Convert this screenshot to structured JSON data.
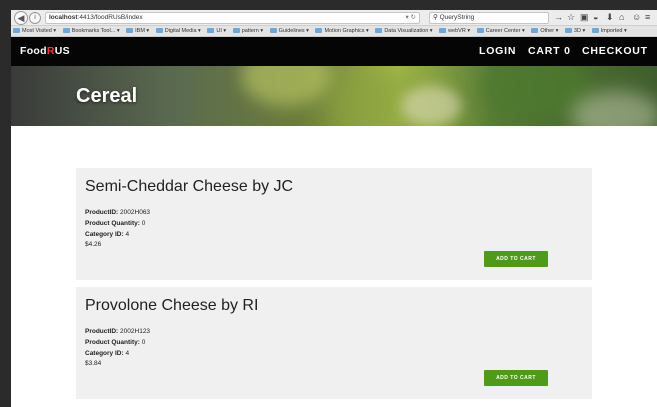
{
  "browser": {
    "url_host": "localhost",
    "url_path": ":4413/foodRUsB/index",
    "search_query": "QueryString",
    "bookmarks": [
      "Most Visited ▾",
      "Bookmarks Tool... ▾",
      "IBM ▾",
      "Digital Media ▾",
      "UI ▾",
      "pattern ▾",
      "Guidelines ▾",
      "Motion Graphics ▾",
      "Data Visualization ▾",
      "webVR ▾",
      "Career Center ▾",
      "Other ▾",
      "3D ▾",
      "Imported ▾"
    ]
  },
  "navbar": {
    "logo_a": "Food",
    "logo_b": "R",
    "logo_c": "US",
    "login": "LOGIN",
    "cart": "CART 0",
    "checkout": "CHECKOUT"
  },
  "hero": {
    "title": "Cereal"
  },
  "products": [
    {
      "title": "Semi-Cheddar Cheese by JC",
      "id_label": "ProductID:",
      "id_value": "2002H063",
      "qty_label": "Product Quantity:",
      "qty_value": "0",
      "cat_label": "Category ID:",
      "cat_value": "4",
      "price": "$4.26",
      "button": "ADD TO CART"
    },
    {
      "title": "Provolone Cheese by RI",
      "id_label": "ProductID:",
      "id_value": "2002H123",
      "qty_label": "Product Quantity:",
      "qty_value": "0",
      "cat_label": "Category ID:",
      "cat_value": "4",
      "price": "$3.84",
      "button": "ADD TO CART"
    }
  ],
  "colors": {
    "accent_button": "#4f9a18",
    "logo_highlight": "#e83a3a",
    "navbar_bg": "#050505"
  }
}
